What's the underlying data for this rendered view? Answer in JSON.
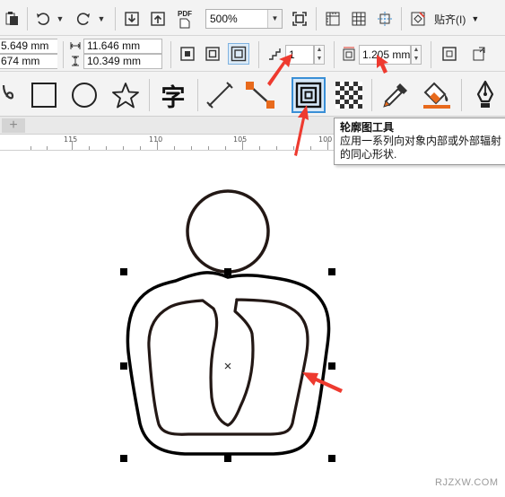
{
  "toolbar_top": {
    "pdf_label": "PDF",
    "zoom_value": "500%",
    "snap_label": "贴齐(I)",
    "icons": [
      "paste-icon",
      "undo-icon",
      "redo-icon",
      "import-icon",
      "export-icon",
      "publish-pdf-icon",
      "full-screen-icon",
      "rulers-icon",
      "grid-icon",
      "guidelines-icon",
      "snap-icon"
    ]
  },
  "property_bar": {
    "x_value": "5.649 mm",
    "y_value": "674 mm",
    "width_value": "11.646 mm",
    "height_value": "10.349 mm",
    "steps_value": "1",
    "offset_value": "1.205 mm"
  },
  "toolbox": {
    "text_tool_glyph": "字",
    "tools": [
      "spiral-tool-icon",
      "rectangle-tool-icon",
      "ellipse-tool-icon",
      "star-tool-icon",
      "text-tool-icon",
      "parallel-dimension-tool-icon",
      "connector-tool-icon",
      "contour-tool-icon",
      "transparency-tool-icon",
      "color-eyedropper-tool-icon",
      "interactive-fill-tool-icon",
      "pen-tool-icon"
    ]
  },
  "tabs": {
    "add_label": "+"
  },
  "ruler": {
    "labels": [
      "115",
      "110",
      "105",
      "100"
    ]
  },
  "tooltip": {
    "title": "轮廓图工具",
    "body": "应用一系列向对象内部或外部辐射的同心形状."
  },
  "watermark": "RJZXW.COM",
  "colors": {
    "accent_red": "#ee3a2f",
    "active_tool_border": "#3a8fd6",
    "toolbar_bg": "#f3f3f3"
  }
}
